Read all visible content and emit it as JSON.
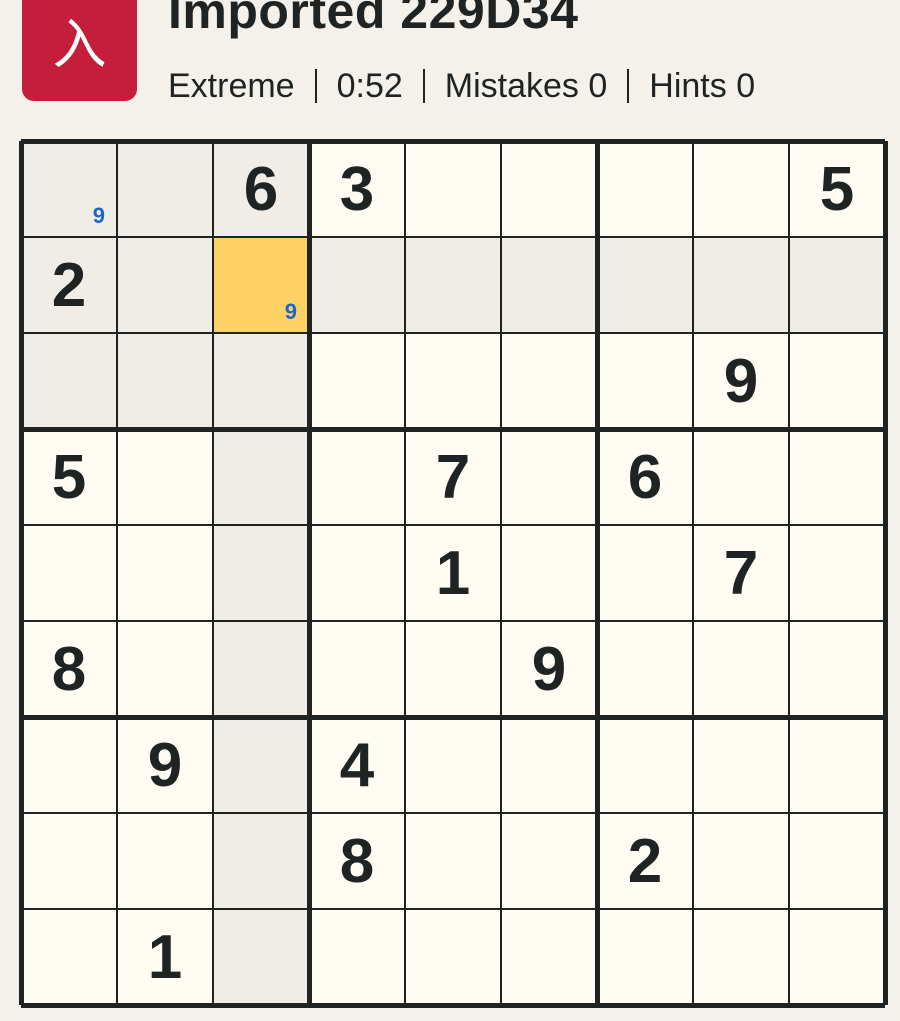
{
  "header": {
    "logo_glyph": "入",
    "title": "Imported 229D34",
    "difficulty": "Extreme",
    "timer": "0:52",
    "mistakes": "Mistakes 0",
    "hints": "Hints 0"
  },
  "colors": {
    "logo_bg": "#c41e3a",
    "selected_cell": "#fdd163",
    "highlight_cell": "#efede6",
    "cell_bg": "#fffcf4",
    "note_color": "#1e66c8",
    "ink": "#1f2322"
  },
  "board": {
    "selected": [
      1,
      2
    ],
    "grid": [
      [
        "",
        "",
        "6",
        "3",
        "",
        "",
        "",
        "",
        "5"
      ],
      [
        "2",
        "",
        "",
        "",
        "",
        "",
        "",
        "",
        ""
      ],
      [
        "",
        "",
        "",
        "",
        "",
        "",
        "",
        "9",
        ""
      ],
      [
        "5",
        "",
        "",
        "",
        "7",
        "",
        "6",
        "",
        ""
      ],
      [
        "",
        "",
        "",
        "",
        "1",
        "",
        "",
        "7",
        ""
      ],
      [
        "8",
        "",
        "",
        "",
        "",
        "9",
        "",
        "",
        ""
      ],
      [
        "",
        "9",
        "",
        "4",
        "",
        "",
        "",
        "",
        ""
      ],
      [
        "",
        "",
        "",
        "8",
        "",
        "",
        "2",
        "",
        ""
      ],
      [
        "",
        "1",
        "",
        "",
        "",
        "",
        "",
        "",
        ""
      ]
    ],
    "notes": [
      {
        "row": 0,
        "col": 0,
        "value": "9"
      },
      {
        "row": 1,
        "col": 2,
        "value": "9"
      }
    ]
  }
}
